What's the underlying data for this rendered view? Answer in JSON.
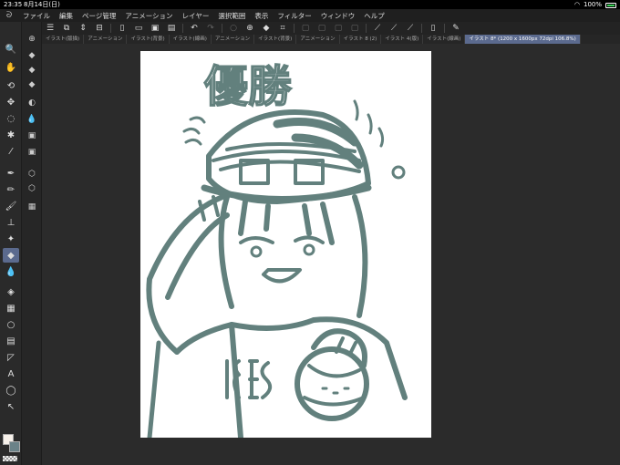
{
  "status": {
    "time": "23:35",
    "date": "8月14日(日)",
    "battery": "100%"
  },
  "menu": [
    "ファイル",
    "編集",
    "ページ管理",
    "アニメーション",
    "レイヤー",
    "選択範囲",
    "表示",
    "フィルター",
    "ウィンドウ",
    "ヘルプ"
  ],
  "tabs": [
    "イラスト(版描)",
    "アニメーション",
    "イラスト(背景)",
    "イラスト(線画)",
    "アニメーション",
    "イラスト(背景)",
    "アニメーション",
    "イラスト 8 (2)",
    "イラスト 4(版)",
    "イラスト(線画)",
    "イラスト 8* (1200 x 1600px 72dpi 106.8%)"
  ],
  "colors": {
    "main": "#f7f1ea",
    "sub": "#6b8288",
    "accent": "#5b6a8e",
    "ink": "#62807d"
  },
  "canvas_text": "優勝"
}
